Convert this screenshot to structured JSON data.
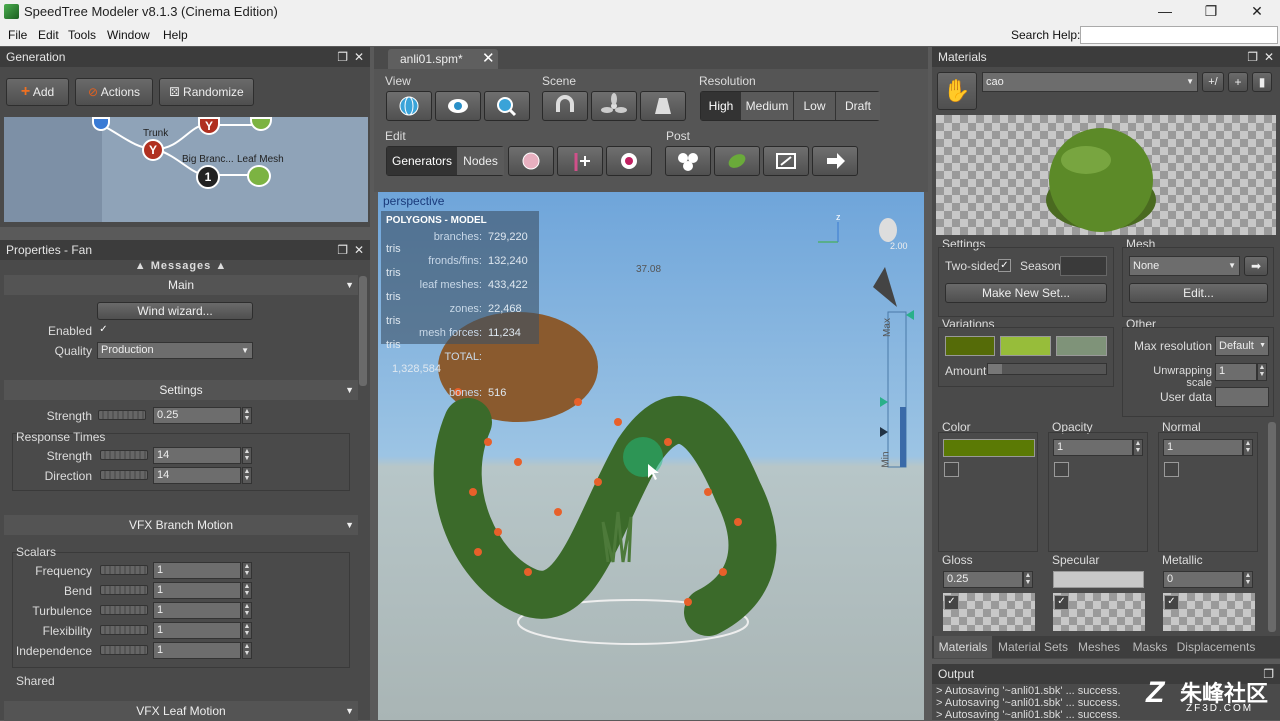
{
  "window": {
    "title": "SpeedTree Modeler v8.1.3 (Cinema Edition)",
    "min": "—",
    "max": "❐",
    "close": "✕"
  },
  "menu": {
    "items": [
      "File",
      "Edit",
      "Tools",
      "Window",
      "Help"
    ],
    "search_label": "Search Help:"
  },
  "generation": {
    "title": "Generation",
    "add": "Add",
    "actions": "Actions",
    "randomize": "Randomize",
    "nodes": {
      "trunk": "Trunk",
      "big_branch": "Big Branc...",
      "leaf_mesh": "Leaf Mesh",
      "badge": "1"
    }
  },
  "properties": {
    "title": "Properties - Fan",
    "messages": "Messages",
    "main": "Main",
    "wind_wizard": "Wind wizard...",
    "enabled_label": "Enabled",
    "quality_label": "Quality",
    "quality_value": "Production",
    "settings": "Settings",
    "strength_label": "Strength",
    "strength_value": "0.25",
    "response_times": "Response Times",
    "rt_strength_label": "Strength",
    "rt_strength_value": "14",
    "rt_direction_label": "Direction",
    "rt_direction_value": "14",
    "vfx_branch": "VFX Branch Motion",
    "scalars": "Scalars",
    "scalar_rows": [
      {
        "label": "Frequency",
        "value": "1"
      },
      {
        "label": "Bend",
        "value": "1"
      },
      {
        "label": "Turbulence",
        "value": "1"
      },
      {
        "label": "Flexibility",
        "value": "1"
      },
      {
        "label": "Independence",
        "value": "1"
      }
    ],
    "shared": "Shared",
    "vfx_leaf": "VFX Leaf Motion"
  },
  "tab": {
    "name": "anli01.spm*",
    "close": "✕"
  },
  "toolbar": {
    "view": "View",
    "scene": "Scene",
    "resolution": "Resolution",
    "res_options": [
      "High",
      "Medium",
      "Low",
      "Draft"
    ],
    "edit": "Edit",
    "generators": "Generators",
    "nodes": "Nodes",
    "post": "Post"
  },
  "viewport": {
    "label": "perspective",
    "stats_title": "POLYGONS - MODEL",
    "stats": [
      {
        "k": "branches:",
        "v": "729,220 tris"
      },
      {
        "k": "fronds/fins:",
        "v": "132,240 tris"
      },
      {
        "k": "leaf meshes:",
        "v": "433,422 tris"
      },
      {
        "k": "zones:",
        "v": "22,468 tris"
      },
      {
        "k": "mesh forces:",
        "v": "11,234 tris"
      },
      {
        "k": "TOTAL:",
        "v": "1,328,584"
      }
    ],
    "bones_label": "bones:",
    "bones_value": "516",
    "measure": "37.08",
    "light_value": "2.00",
    "axis_z": "z",
    "max_label": "Max",
    "min_label": "Min"
  },
  "materials": {
    "title": "Materials",
    "name": "cao",
    "settings": "Settings",
    "two_sided": "Two-sided",
    "season": "Season",
    "make_new_set": "Make New Set...",
    "mesh": "Mesh",
    "mesh_value": "None",
    "edit": "Edit...",
    "variations": "Variations",
    "amount": "Amount",
    "variation_colors": [
      "#556b08",
      "#97bd3a",
      "#7f9379"
    ],
    "other": "Other",
    "max_res_label": "Max resolution",
    "max_res_value": "Default",
    "unwrap_label": "Unwrapping scale",
    "unwrap_value": "1",
    "user_data": "User data",
    "color": "Color",
    "color_value": "#5b7a05",
    "opacity": "Opacity",
    "opacity_value": "1",
    "normal": "Normal",
    "normal_value": "1",
    "gloss": "Gloss",
    "gloss_value": "0.25",
    "specular": "Specular",
    "metallic": "Metallic",
    "metallic_value": "0",
    "tabs": [
      "Materials",
      "Material Sets",
      "Meshes",
      "Masks",
      "Displacements"
    ]
  },
  "output": {
    "title": "Output",
    "lines": [
      "> Autosaving '~anli01.sbk' ... success.",
      "> Autosaving '~anli01.sbk' ... success.",
      "> Autosaving '~anli01.sbk' ... success."
    ]
  },
  "watermark": {
    "text": "朱峰社区",
    "sub": "ZF3D.COM"
  }
}
